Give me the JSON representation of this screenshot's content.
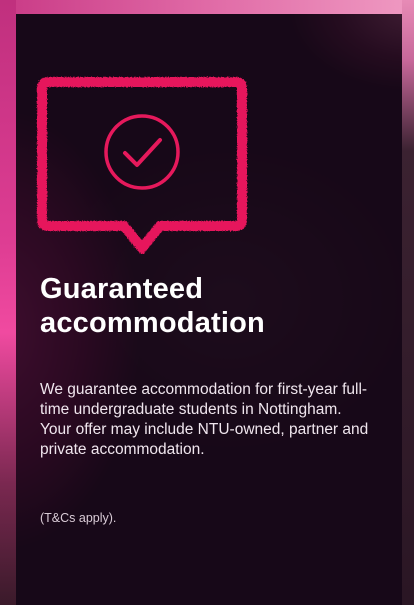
{
  "card": {
    "icon": "speech-bubble-checkmark-icon",
    "title": "Guaranteed accommodation",
    "body": "We guarantee accommodation for first-year full-time undergraduate students in Nottingham. Your offer may include NTU-owned, partner and private accommodation.",
    "note": "(T&Cs apply)."
  },
  "colors": {
    "accent": "#e6195c",
    "title": "#ffffff",
    "overlay": "#160818"
  }
}
